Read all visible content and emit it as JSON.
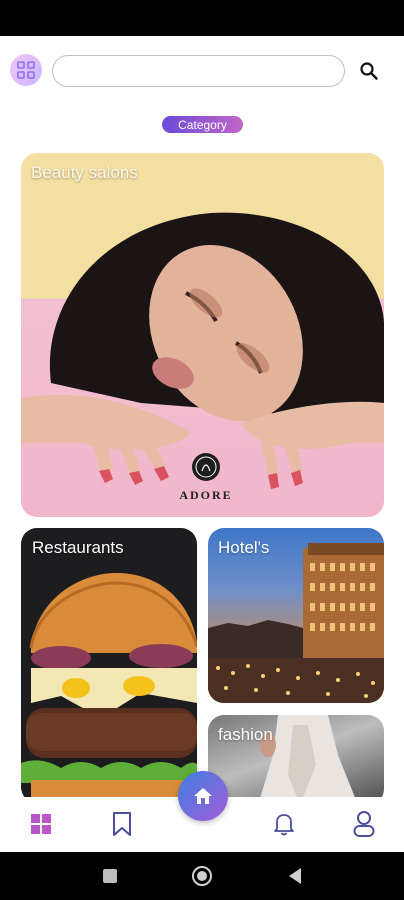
{
  "header": {
    "search_value": "",
    "search_placeholder": ""
  },
  "category_label": "Category",
  "cards": {
    "beauty_title": "Beauty salons",
    "beauty_logo_text": "ADORE",
    "restaurants_title": "Restaurants",
    "hotels_title": "Hotel's",
    "fashion_title": "fashion"
  },
  "colors": {
    "accent_gradient_start": "#6a4bd8",
    "accent_gradient_end": "#c266c9",
    "nav_icon": "#4a4f9a",
    "grid_icon": "#b656c9"
  },
  "icons": {
    "logo": "logo-icon",
    "search": "search-icon",
    "grid": "grid-icon",
    "bookmark": "bookmark-icon",
    "home": "home-icon",
    "bell": "bell-icon",
    "profile": "profile-icon"
  }
}
